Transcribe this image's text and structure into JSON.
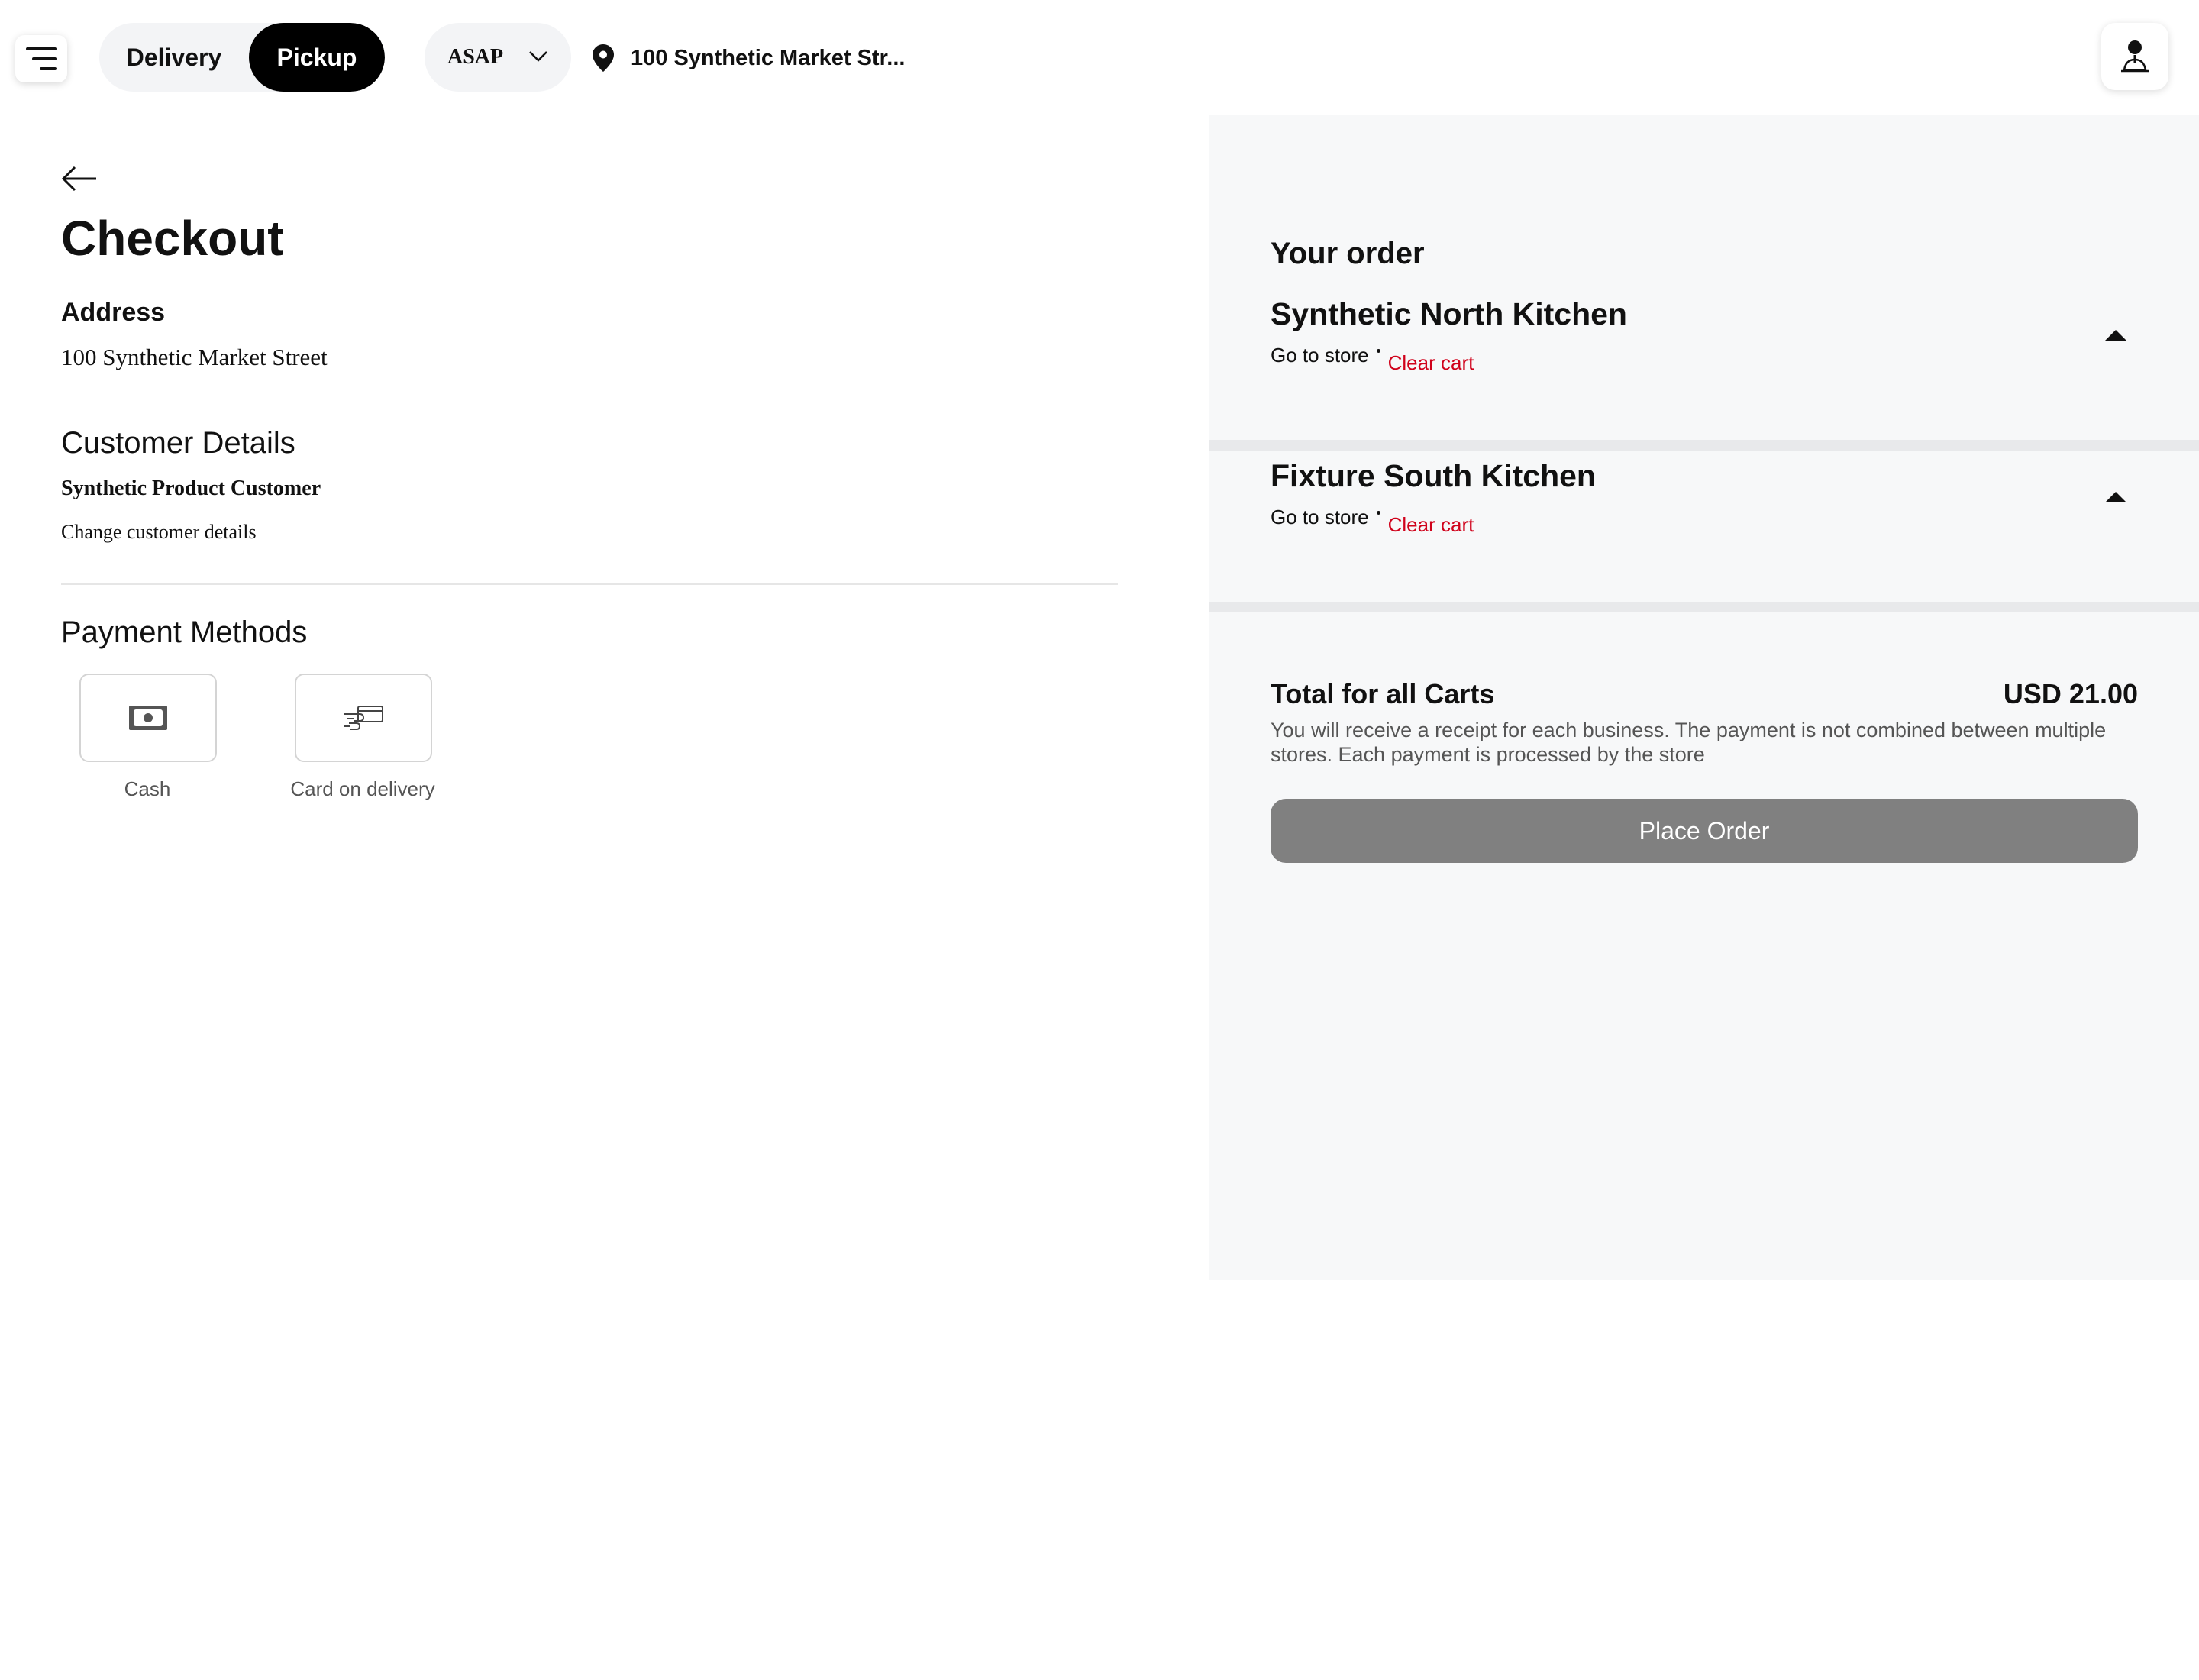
{
  "header": {
    "mode_toggle": {
      "delivery_label": "Delivery",
      "pickup_label": "Pickup",
      "selected": "Pickup"
    },
    "time_select": {
      "value": "ASAP"
    },
    "address": {
      "value": "100 Synthetic Market Str..."
    },
    "icons": {
      "menu": "menu-icon",
      "time_chevron": "chevron-down-icon",
      "location": "location-pin-icon",
      "profile": "user-icon"
    }
  },
  "checkout": {
    "title": "Checkout",
    "address_heading": "Address",
    "address_value": "100 Synthetic Market Street",
    "customer_heading": "Customer Details",
    "customer_name": "Synthetic Product Customer",
    "change_customer_label": "Change customer details",
    "payment_heading": "Payment Methods",
    "payment_methods": [
      {
        "label": "Cash",
        "icon": "cash-icon"
      },
      {
        "label": "Card on delivery",
        "icon": "card-hand-icon"
      }
    ]
  },
  "order": {
    "title": "Your order",
    "carts": [
      {
        "store": "Synthetic North Kitchen",
        "go_to_store": "Go to store",
        "clear_cart": "Clear cart"
      },
      {
        "store": "Fixture South Kitchen",
        "go_to_store": "Go to store",
        "clear_cart": "Clear cart"
      }
    ],
    "total_label": "Total for all Carts",
    "total_value": "USD 21.00",
    "total_note": "You will receive a receipt for each business. The payment is not combined between multiple stores. Each payment is processed by the store",
    "place_order_label": "Place Order"
  },
  "colors": {
    "accent": "#000000",
    "clear_cart": "#d0021b",
    "panel_bg": "#f7f8f9",
    "button_disabled": "#808080"
  }
}
